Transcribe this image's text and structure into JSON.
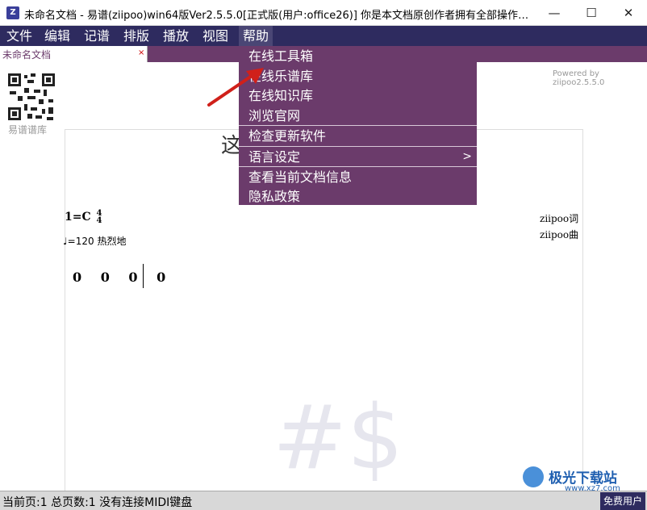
{
  "window": {
    "title": "未命名文档 - 易谱(ziipoo)win64版Ver2.5.5.0[正式版(用户:office26)] 你是本文档原创作者拥有全部操作权限-succes...",
    "app_icon_glyph": "Z",
    "minimize_glyph": "—",
    "maximize_glyph": "☐",
    "close_glyph": "✕"
  },
  "menubar": {
    "items": [
      "文件",
      "编辑",
      "记谱",
      "排版",
      "播放",
      "视图",
      "帮助"
    ]
  },
  "tab": {
    "label": "未命名文档",
    "close_glyph": "×"
  },
  "help_menu": {
    "items": [
      "在线工具箱",
      "在线乐谱库",
      "在线知识库",
      "浏览官网",
      "检查更新软件",
      "语言设定",
      "查看当前文档信息",
      "隐私政策"
    ],
    "submenu_arrow": ">"
  },
  "canvas": {
    "qr_label": "易谱谱库",
    "powered_by": "Powered by ziipoo2.5.5.0",
    "title_partial": "这",
    "key_signature": "1=C",
    "time_signature_top": "4",
    "time_signature_bottom": "4",
    "tempo_symbol": "♩",
    "tempo_text": "=120 热烈地",
    "lyricist": "ziipoo词",
    "composer": "ziipoo曲",
    "notes": "0 0 0 0",
    "watermark": "#$"
  },
  "statusbar": {
    "text": "当前页:1 总页数:1 没有连接MIDI键盘",
    "user_label": "免费用户"
  },
  "site_watermark": {
    "name": "极光下载站",
    "url": "www.xz7.com"
  },
  "colors": {
    "menubar_bg": "#2e2b5f",
    "dropdown_bg": "#6b3b6b",
    "tab_strip_bg": "#6b3b6b",
    "annotation_arrow": "#d0201a"
  }
}
